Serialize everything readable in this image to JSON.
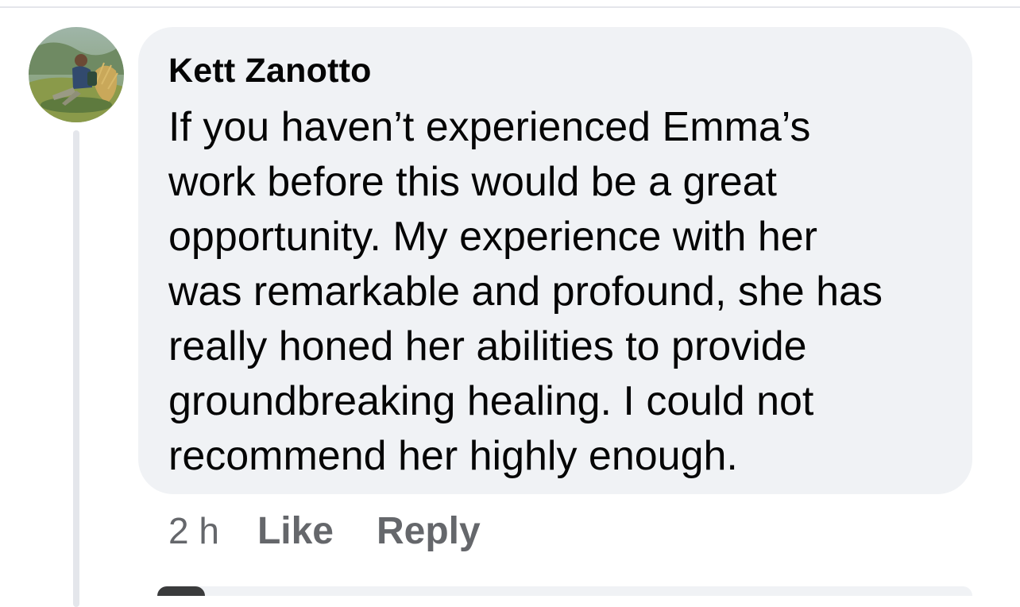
{
  "comment": {
    "author": "Kett Zanotto",
    "text_lines": [
      "If you haven’t experienced Emma’s",
      "work before this would be a great",
      "opportunity. My experience with her",
      "was remarkable and profound, she has",
      "really honed her abilities to provide",
      "groundbreaking healing. I could not",
      "recommend her highly enough."
    ],
    "timestamp": "2 h",
    "like_label": "Like",
    "reply_label": "Reply"
  },
  "colors": {
    "bubble": "#f0f2f5",
    "text": "#050505",
    "secondary": "#65676b",
    "divider": "#e4e6eb"
  }
}
